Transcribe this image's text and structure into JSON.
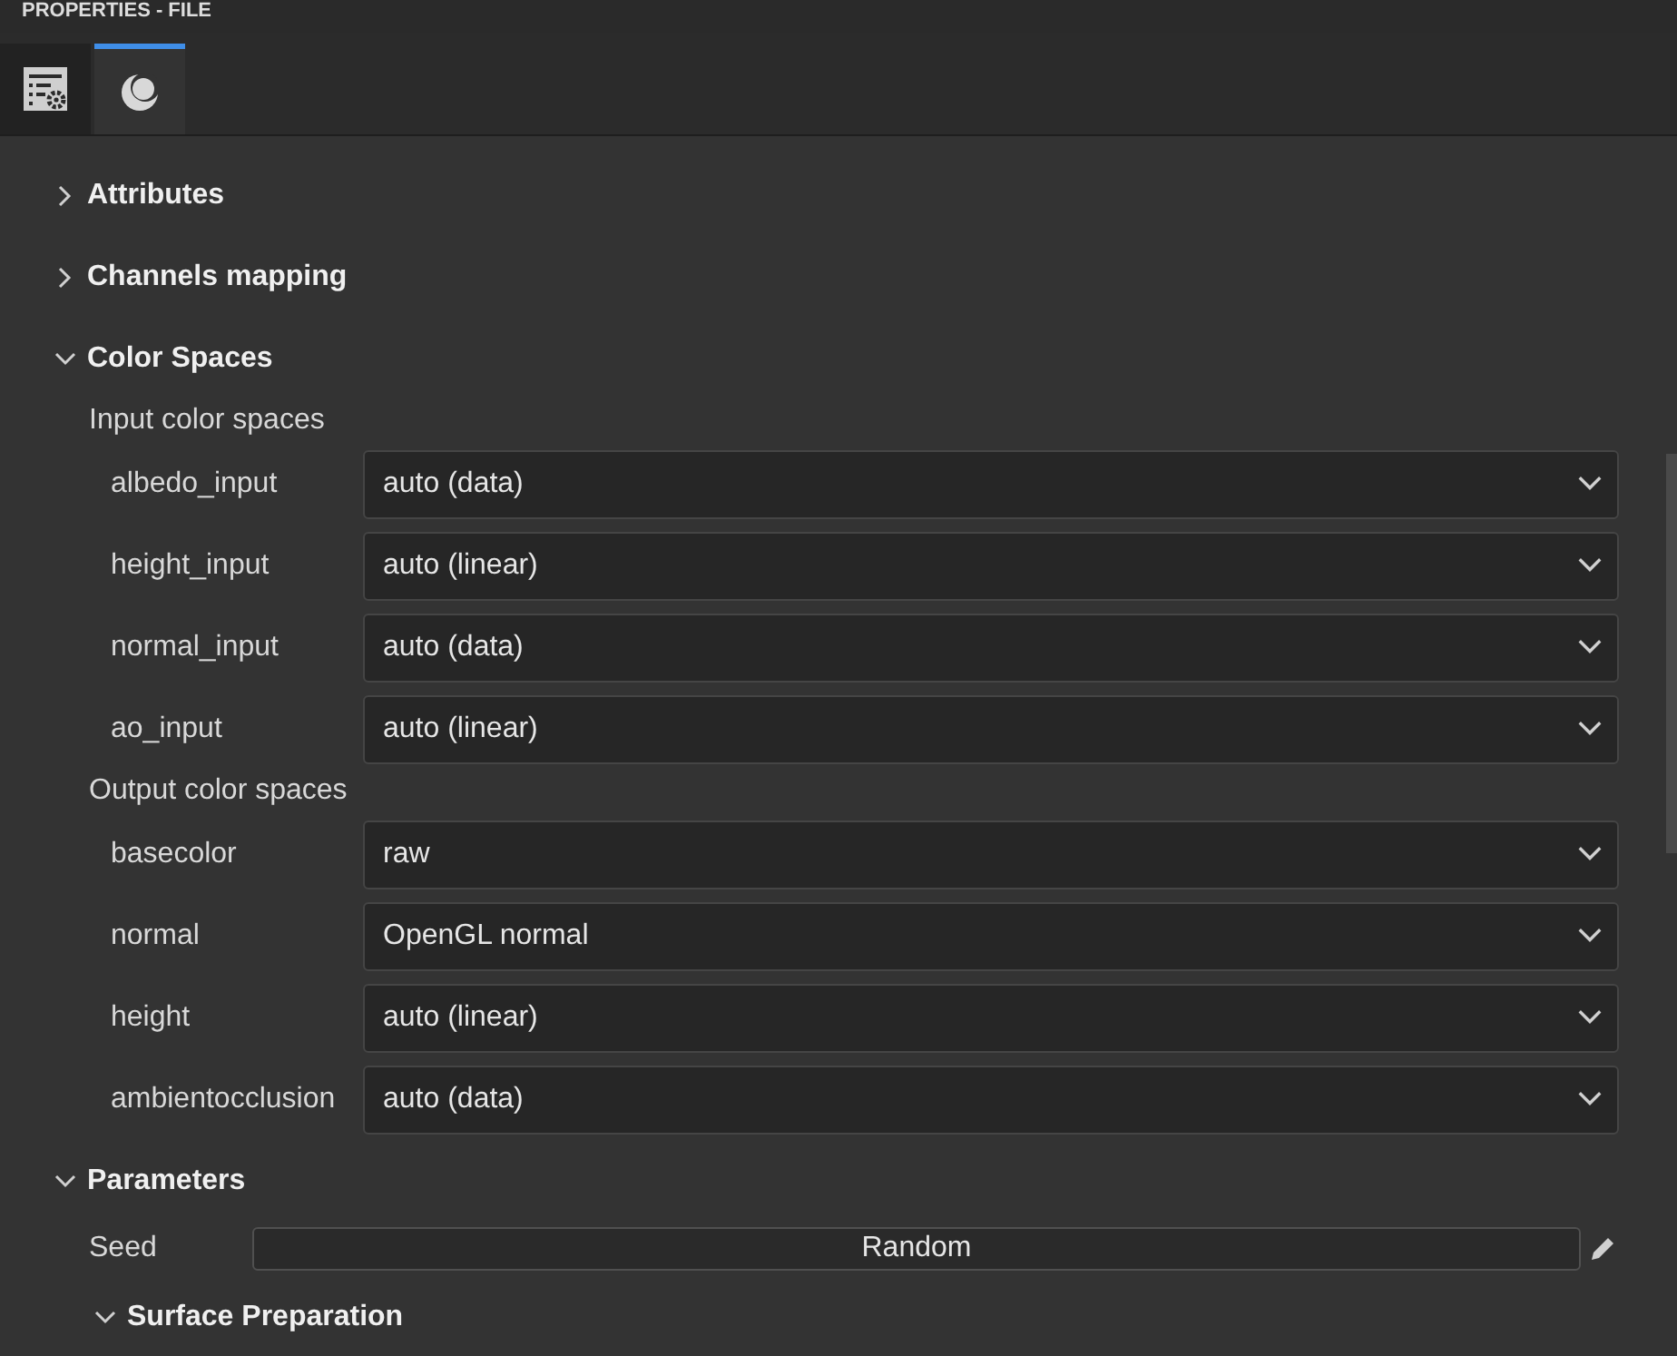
{
  "window": {
    "title": "PROPERTIES - FILE"
  },
  "tabs": [
    {
      "selected": false
    },
    {
      "selected": true
    }
  ],
  "sections": [
    {
      "title": "Attributes",
      "expanded": false
    },
    {
      "title": "Channels mapping",
      "expanded": false
    },
    {
      "title": "Color Spaces",
      "expanded": true,
      "items": [
        {
          "kind": "group",
          "label": "Input color spaces"
        },
        {
          "kind": "dropdown",
          "label": "albedo_input",
          "value": "auto (data)"
        },
        {
          "kind": "dropdown",
          "label": "height_input",
          "value": "auto (linear)"
        },
        {
          "kind": "dropdown",
          "label": "normal_input",
          "value": "auto (data)"
        },
        {
          "kind": "dropdown",
          "label": "ao_input",
          "value": "auto (linear)"
        },
        {
          "kind": "group",
          "label": "Output color spaces"
        },
        {
          "kind": "dropdown",
          "label": "basecolor",
          "value": "raw"
        },
        {
          "kind": "dropdown",
          "label": "normal",
          "value": "OpenGL normal"
        },
        {
          "kind": "dropdown",
          "label": "height",
          "value": "auto (linear)"
        },
        {
          "kind": "dropdown",
          "label": "ambientocclusion",
          "value": "auto (data)"
        }
      ]
    },
    {
      "title": "Parameters",
      "expanded": true,
      "items": [
        {
          "kind": "button",
          "label": "Seed",
          "value": "Random"
        },
        {
          "kind": "subsection",
          "label": "Surface Preparation",
          "expanded": true
        }
      ]
    }
  ]
}
